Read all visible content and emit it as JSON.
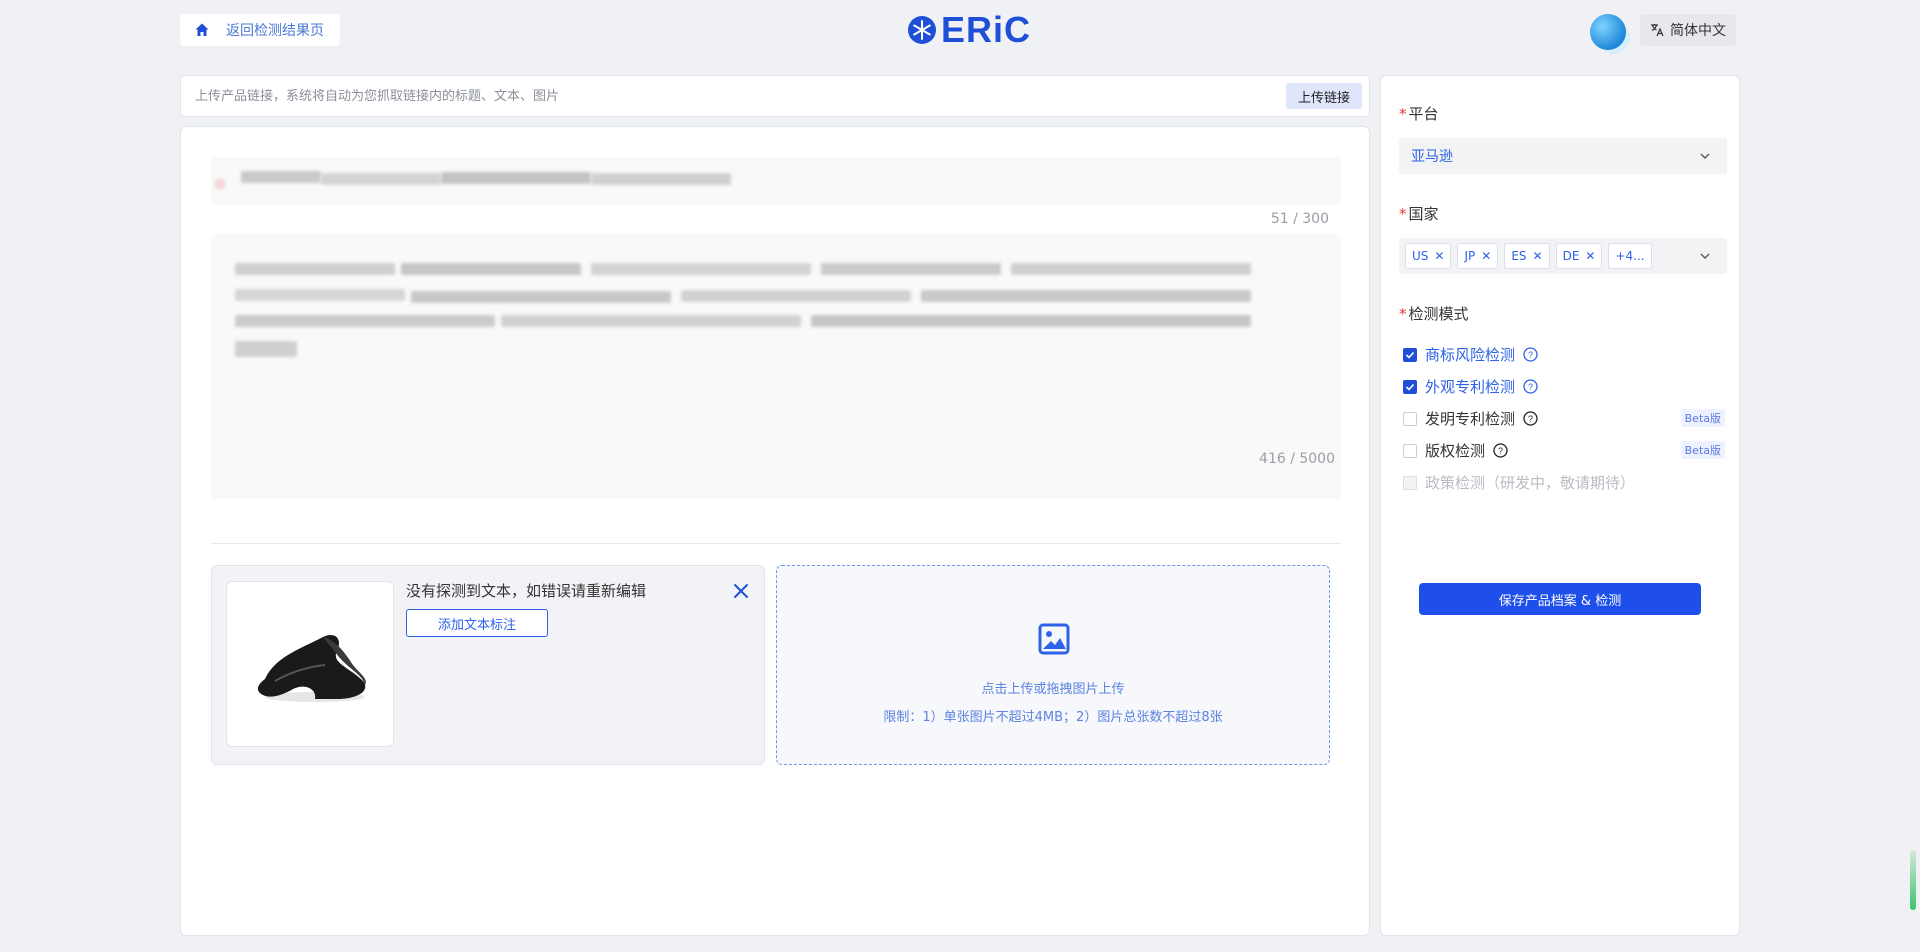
{
  "header": {
    "back_label": "返回检测结果页",
    "logo_text": "ERiC",
    "language_label": "简体中文"
  },
  "url_bar": {
    "placeholder": "上传产品链接，系统将自动为您抓取链接内的标题、文本、图片",
    "upload_label": "上传链接"
  },
  "product": {
    "title_counter": "51 / 300",
    "desc_counter": "416 / 5000"
  },
  "image_card": {
    "no_text_message": "没有探测到文本，如错误请重新编辑",
    "add_annotation_label": "添加文本标注"
  },
  "dropzone": {
    "title": "点击上传或拖拽图片上传",
    "limit": "限制：1）单张图片不超过4MB；2）图片总张数不超过8张"
  },
  "side": {
    "platform_label": "平台",
    "platform_value": "亚马逊",
    "country_label": "国家",
    "countries": [
      "US",
      "JP",
      "ES",
      "DE"
    ],
    "country_more": "+4...",
    "mode_label": "检测模式",
    "modes": [
      {
        "label": "商标风险检测",
        "checked": true,
        "disabled": false,
        "beta": ""
      },
      {
        "label": "外观专利检测",
        "checked": true,
        "disabled": false,
        "beta": ""
      },
      {
        "label": "发明专利检测",
        "checked": false,
        "disabled": false,
        "beta": "Beta版"
      },
      {
        "label": "版权检测",
        "checked": false,
        "disabled": false,
        "beta": "Beta版"
      },
      {
        "label": "政策检测（研发中，敬请期待）",
        "checked": false,
        "disabled": true,
        "beta": ""
      }
    ],
    "save_label": "保存产品档案 & 检测"
  },
  "colors": {
    "accent": "#1f4fea",
    "link": "#2e62e8",
    "required": "#e23b3b",
    "background": "#f0f1f5"
  }
}
